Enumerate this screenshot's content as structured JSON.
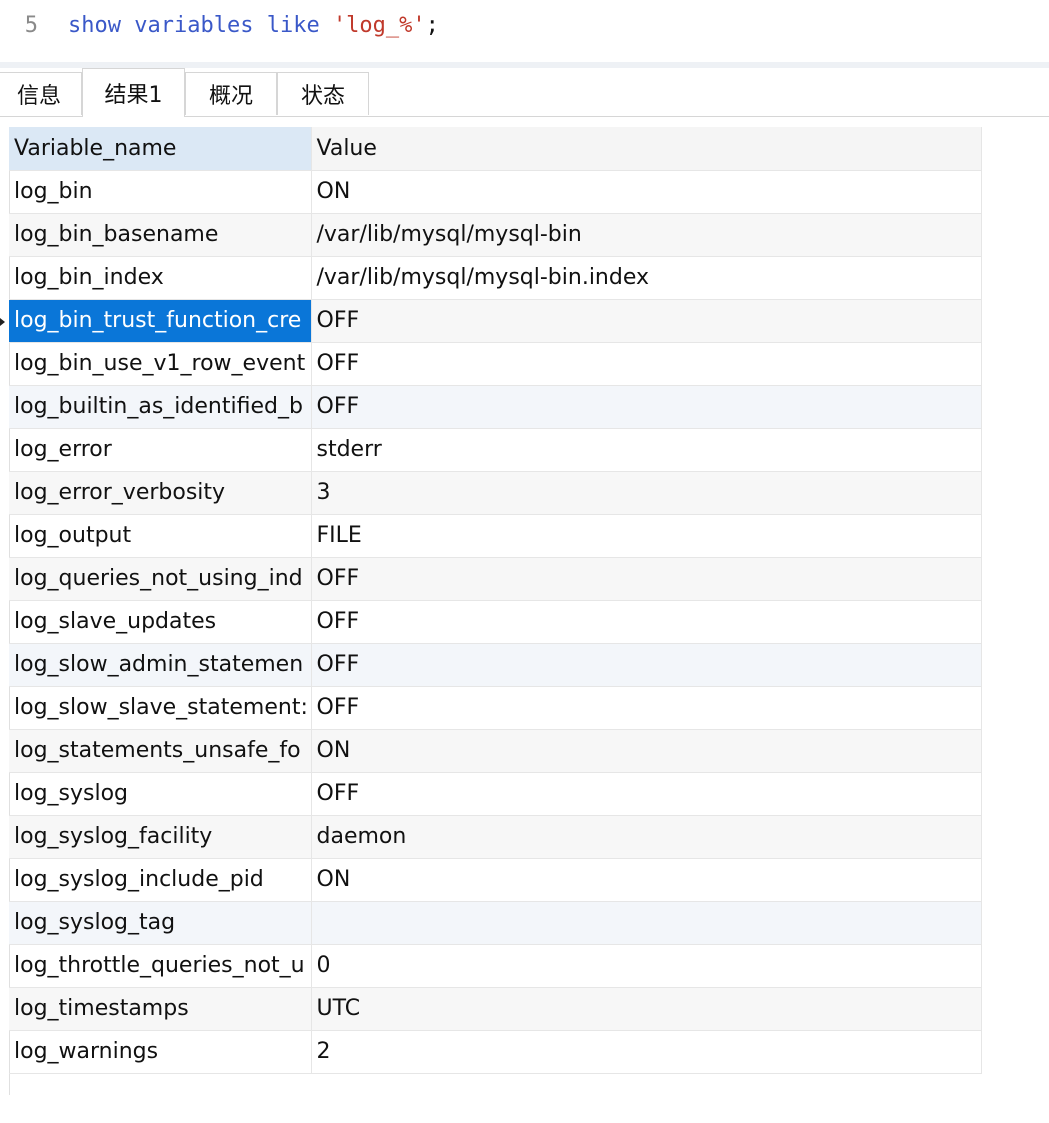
{
  "editor": {
    "line_number": "5",
    "kw1": "show",
    "kw2": "variables",
    "kw3": "like",
    "string": "'log_%'",
    "semicolon": ";"
  },
  "tabs": [
    {
      "label": "信息",
      "active": false
    },
    {
      "label": "结果1",
      "active": true
    },
    {
      "label": "概况",
      "active": false
    },
    {
      "label": "状态",
      "active": false
    }
  ],
  "grid": {
    "columns": [
      "Variable_name",
      "Value"
    ],
    "selected_row": 3,
    "rows": [
      [
        "log_bin",
        "ON"
      ],
      [
        "log_bin_basename",
        "/var/lib/mysql/mysql-bin"
      ],
      [
        "log_bin_index",
        "/var/lib/mysql/mysql-bin.index"
      ],
      [
        "log_bin_trust_function_cre",
        "OFF"
      ],
      [
        "log_bin_use_v1_row_event",
        "OFF"
      ],
      [
        "log_builtin_as_identified_b",
        "OFF"
      ],
      [
        "log_error",
        "stderr"
      ],
      [
        "log_error_verbosity",
        "3"
      ],
      [
        "log_output",
        "FILE"
      ],
      [
        "log_queries_not_using_ind",
        "OFF"
      ],
      [
        "log_slave_updates",
        "OFF"
      ],
      [
        "log_slow_admin_statemen",
        "OFF"
      ],
      [
        "log_slow_slave_statement:",
        "OFF"
      ],
      [
        "log_statements_unsafe_fo",
        "ON"
      ],
      [
        "log_syslog",
        "OFF"
      ],
      [
        "log_syslog_facility",
        "daemon"
      ],
      [
        "log_syslog_include_pid",
        "ON"
      ],
      [
        "log_syslog_tag",
        ""
      ],
      [
        "log_throttle_queries_not_u",
        "0"
      ],
      [
        "log_timestamps",
        "UTC"
      ],
      [
        "log_warnings",
        "2"
      ]
    ]
  }
}
